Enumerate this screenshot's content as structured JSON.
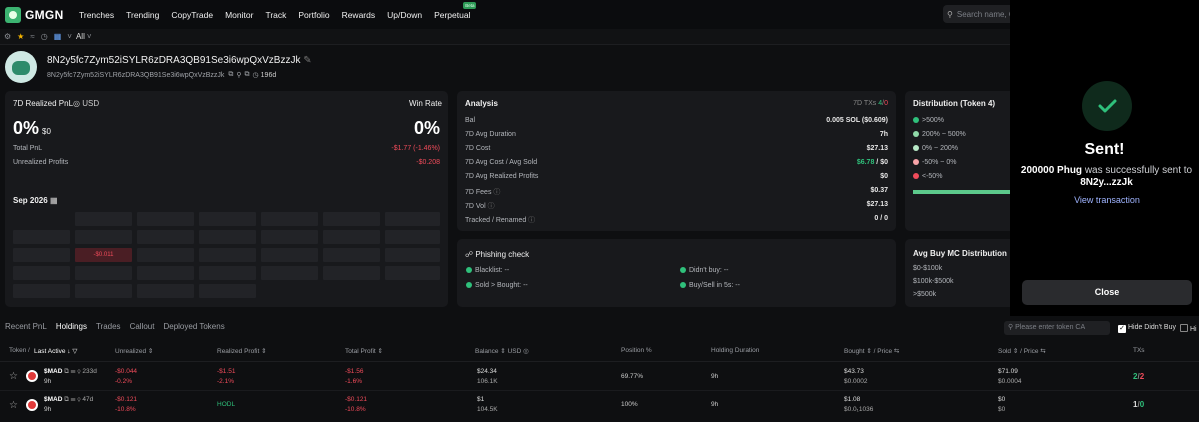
{
  "brand": {
    "name": "GMGN"
  },
  "nav": [
    "Trenches",
    "Trending",
    "CopyTrade",
    "Monitor",
    "Track",
    "Portfolio",
    "Rewards",
    "Up/Down",
    "Perpetual"
  ],
  "nav_badge": "Beta",
  "search": {
    "placeholder": "Search name, C"
  },
  "filterbar": {
    "all_label": "All"
  },
  "profile": {
    "address": "8N2y5fc7Zym52iSYLR6zDRA3QB91Se3i6wpQxVzBzzJk",
    "address_short": "8N2y5fc7Zym52iSYLR6zDRA3QB91Se3i6wpQxVzBzzJk",
    "age": "196d"
  },
  "pnl_card": {
    "title": "7D Realized PnL",
    "currency": "USD",
    "win_rate_label": "Win Rate",
    "pnl_pct": "0%",
    "pnl_usd": "$0",
    "win_rate": "0%",
    "total_pnl_label": "Total PnL",
    "total_pnl": "-$1.77 (-1.46%)",
    "unrealized_label": "Unrealized Profits",
    "unrealized": "-$0.208",
    "month": "Sep 2026",
    "cal_value": "-$0.011"
  },
  "analysis": {
    "title": "Analysis",
    "txs_label": "7D TXs",
    "txs_win": "4",
    "txs_loss": "0",
    "rows": [
      {
        "label": "Bal",
        "value": "0.005 SOL ($0.609)"
      },
      {
        "label": "7D Avg Duration",
        "value": "7h"
      },
      {
        "label": "7D Cost",
        "value": "$27.13"
      },
      {
        "label": "7D Avg Cost / Avg Sold",
        "value_a": "$6.78",
        "value_b": "$0"
      },
      {
        "label": "7D Avg Realized Profits",
        "value": "$0"
      },
      {
        "label": "7D Fees",
        "value": "$0.37"
      },
      {
        "label": "7D Vol",
        "value": "$27.13"
      },
      {
        "label": "Tracked / Renamed",
        "value": "0 / 0"
      }
    ]
  },
  "phishing": {
    "title": "Phishing check",
    "items": [
      "Blacklist: --",
      "Didn't buy: --",
      "Sold > Bought: --",
      "Buy/Sell in 5s: --"
    ]
  },
  "distribution": {
    "title": "Distribution (Token 4)",
    "items": [
      ">500%",
      "200% ~ 500%",
      "0% ~ 200%",
      "-50% ~ 0%",
      "<-50%"
    ],
    "colors": [
      "#2fc07b",
      "#8fd9a8",
      "#b7e8c6",
      "#f7a3a8",
      "#f04b5a"
    ]
  },
  "mc": {
    "title": "Avg Buy MC Distribution",
    "items": [
      "$0-$100k",
      "$100k-$500k",
      ">$500k"
    ]
  },
  "tabs": [
    "Recent PnL",
    "Holdings",
    "Trades",
    "Callout",
    "Deployed Tokens"
  ],
  "token_search": {
    "placeholder": "Please enter token CA"
  },
  "hide_didnt_buy": "Hide Didn't Buy",
  "hide_other": "Hi",
  "columns": [
    "Token",
    "Last Active",
    "Unrealized",
    "Realized Profit",
    "Total Profit",
    "Balance",
    "USD",
    "Position %",
    "Holding Duration",
    "Bought",
    "Price",
    "Sold",
    "Price",
    "TXs"
  ],
  "rows": [
    {
      "token": "$MAD",
      "age": "233d",
      "time": "9h",
      "unreal": "-$0.044",
      "unreal_pct": "-0.2%",
      "real": "-$1.51",
      "real_pct": "-2.1%",
      "total": "-$1.56",
      "total_pct": "-1.6%",
      "bal": "$24.34",
      "bal_sub": "106.1K",
      "pos": "69.77%",
      "dur": "9h",
      "bought": "$43.73",
      "bought_price": "$0.0002",
      "sold": "$71.09",
      "sold_price": "$0.0004",
      "tx_b": "2",
      "tx_s": "2"
    },
    {
      "token": "$MAD",
      "age": "47d",
      "time": "9h",
      "unreal": "-$0.121",
      "unreal_pct": "-10.8%",
      "real": "HODL",
      "real_pct": "",
      "total": "-$0.121",
      "total_pct": "-10.8%",
      "bal": "$1",
      "bal_sub": "104.5K",
      "pos": "100%",
      "dur": "9h",
      "bought": "$1.08",
      "bought_price": "$0.0₁1036",
      "sold": "$0",
      "sold_price": "$0",
      "tx_b": "1",
      "tx_s": "0"
    }
  ],
  "toast": {
    "title": "Sent!",
    "amount": "200000 Phug",
    "msg": "was successfully sent to",
    "dest": "8N2y...zzJk",
    "link": "View transaction",
    "close": "Close"
  }
}
